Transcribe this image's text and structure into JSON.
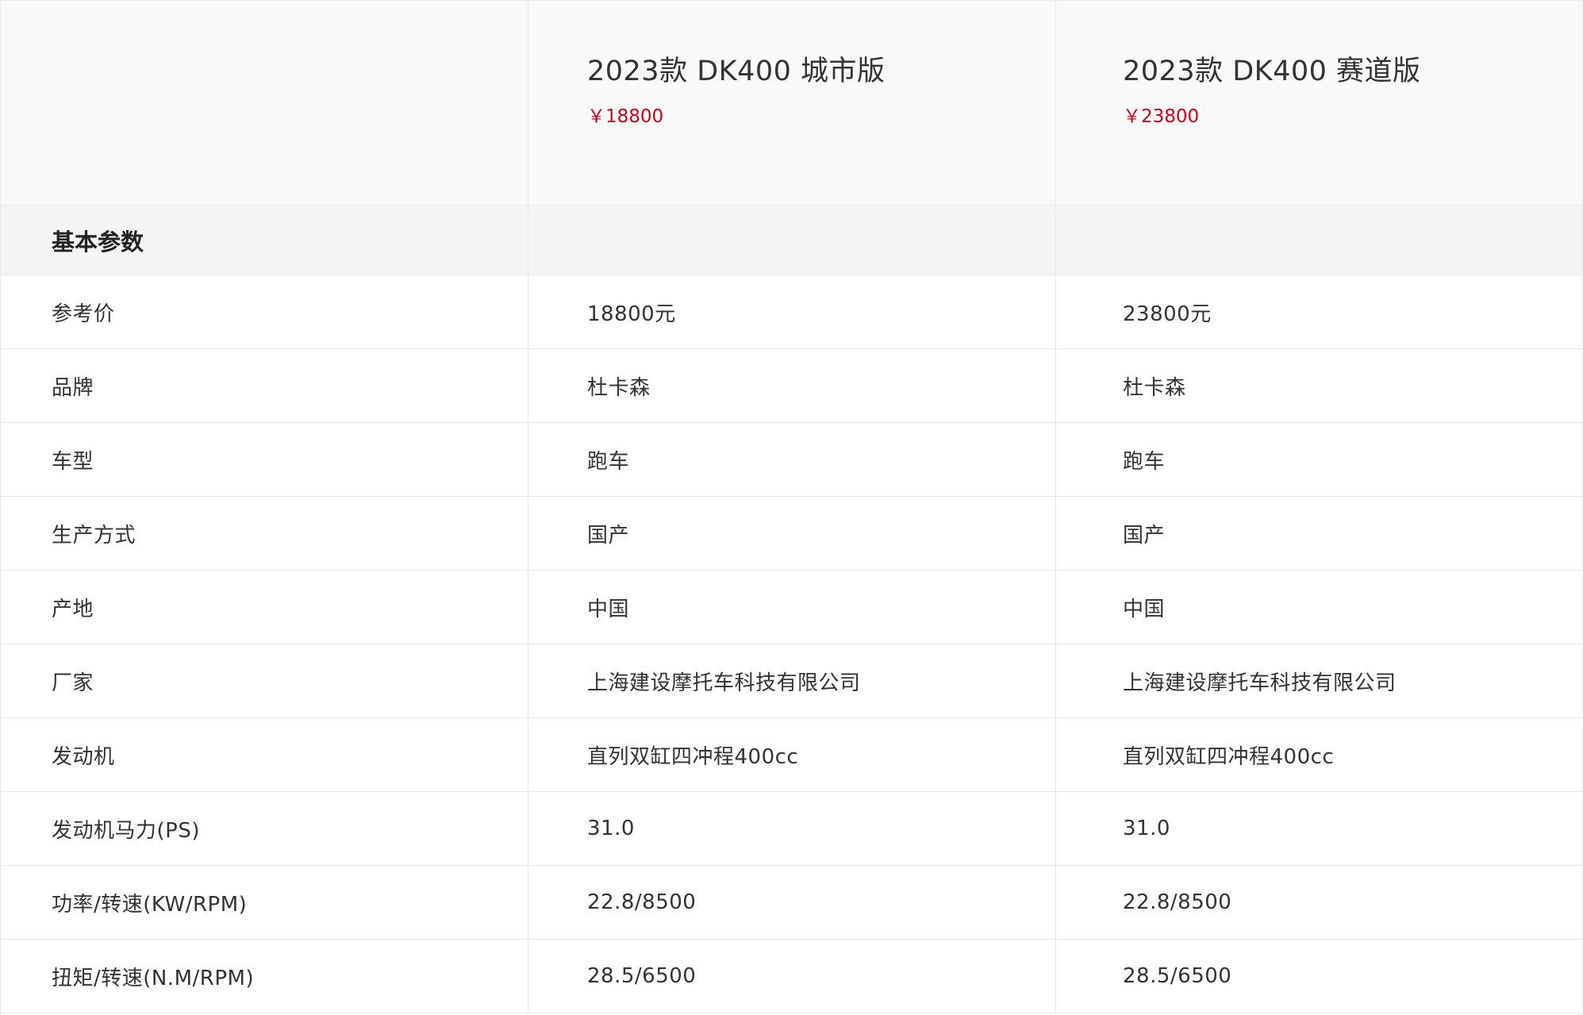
{
  "models": [
    {
      "name": "2023款 DK400 城市版",
      "price": "￥18800"
    },
    {
      "name": "2023款 DK400 赛道版",
      "price": "￥23800"
    }
  ],
  "section": {
    "title": "基本参数"
  },
  "colors": {
    "price": "#d0021b",
    "header_bg": "#f9f9f9",
    "section_bg": "#f4f4f4",
    "border": "#e8e8e8"
  },
  "rows": [
    {
      "label": "参考价",
      "values": [
        "18800元",
        "23800元"
      ]
    },
    {
      "label": "品牌",
      "values": [
        "杜卡森",
        "杜卡森"
      ]
    },
    {
      "label": "车型",
      "values": [
        "跑车",
        "跑车"
      ]
    },
    {
      "label": "生产方式",
      "values": [
        "国产",
        "国产"
      ]
    },
    {
      "label": "产地",
      "values": [
        "中国",
        "中国"
      ]
    },
    {
      "label": "厂家",
      "values": [
        "上海建设摩托车科技有限公司",
        "上海建设摩托车科技有限公司"
      ]
    },
    {
      "label": "发动机",
      "values": [
        "直列双缸四冲程400cc",
        "直列双缸四冲程400cc"
      ]
    },
    {
      "label": "发动机马力(PS)",
      "values": [
        "31.0",
        "31.0"
      ]
    },
    {
      "label": "功率/转速(KW/RPM)",
      "values": [
        "22.8/8500",
        "22.8/8500"
      ]
    },
    {
      "label": "扭矩/转速(N.M/RPM)",
      "values": [
        "28.5/6500",
        "28.5/6500"
      ]
    }
  ]
}
